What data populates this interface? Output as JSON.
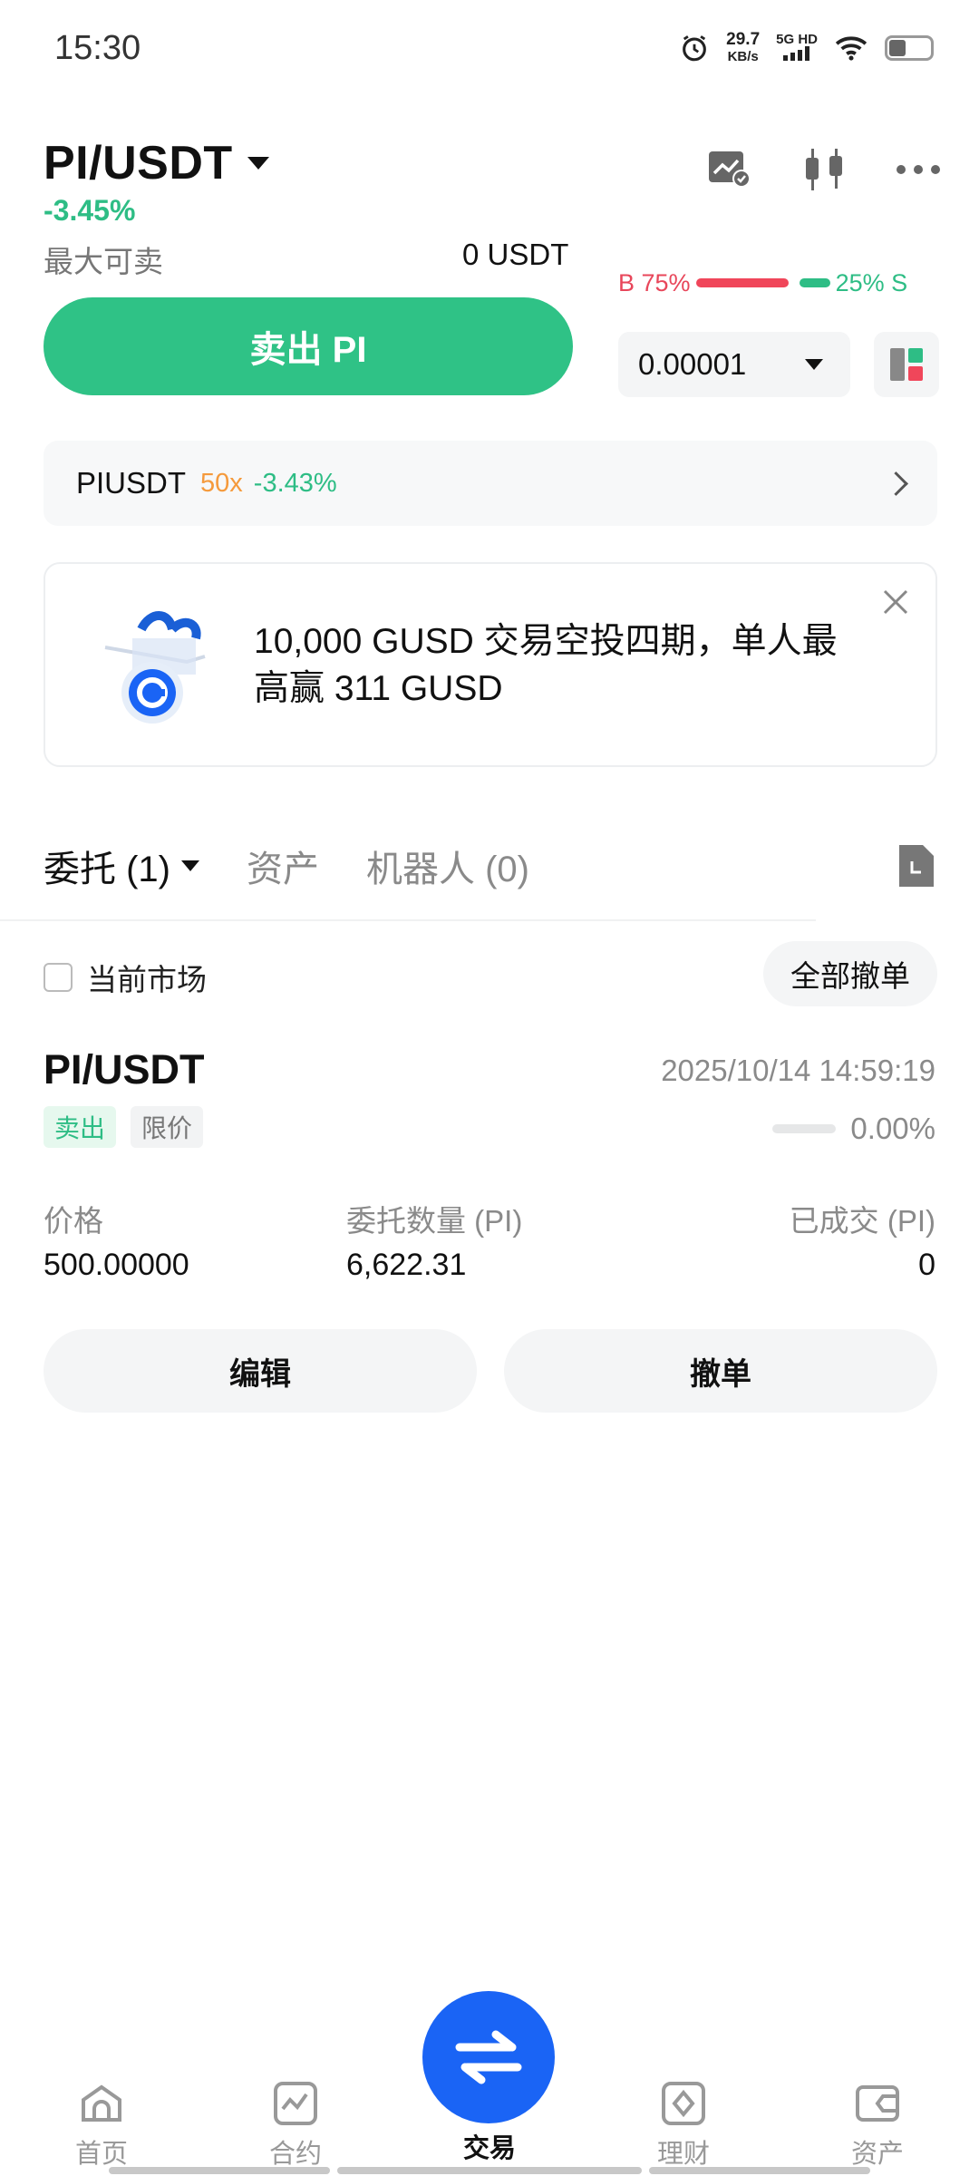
{
  "status_bar": {
    "time": "15:30",
    "speed_value": "29.7",
    "speed_unit": "KB/s",
    "network": "5G HD"
  },
  "header": {
    "pair": "PI/USDT",
    "change": "-3.45%"
  },
  "max_sell": {
    "label": "最大可卖",
    "value": "0 USDT"
  },
  "sell_button": {
    "label": "卖出 PI"
  },
  "ratio": {
    "buy_label": "B 75%",
    "sell_label": "25% S",
    "buy_fraction": 0.75
  },
  "precision": {
    "value": "0.00001"
  },
  "contract": {
    "symbol": "PIUSDT",
    "leverage": "50x",
    "change": "-3.43%"
  },
  "banner": {
    "text": "10,000 GUSD 交易空投四期，单人最高赢 311 GUSD"
  },
  "tabs": {
    "orders": "委托 (1)",
    "assets": "资产",
    "bots": "机器人 (0)"
  },
  "filter": {
    "current_market": "当前市场",
    "cancel_all": "全部撤单"
  },
  "order": {
    "pair": "PI/USDT",
    "time": "2025/10/14 14:59:19",
    "side": "卖出",
    "type": "限价",
    "filled_pct": "0.00%",
    "filled_fraction": 0,
    "price_label": "价格",
    "price": "500.00000",
    "amount_label": "委托数量 (PI)",
    "amount": "6,622.31",
    "filled_label": "已成交 (PI)",
    "filled": "0",
    "edit": "编辑",
    "cancel": "撤单"
  },
  "nav": {
    "home": "首页",
    "futures": "合约",
    "trade": "交易",
    "earn": "理财",
    "assets": "资产"
  },
  "colors": {
    "green": "#2ebd85",
    "red": "#f0465a",
    "blue": "#1a64f5",
    "orange": "#f59a3c"
  }
}
